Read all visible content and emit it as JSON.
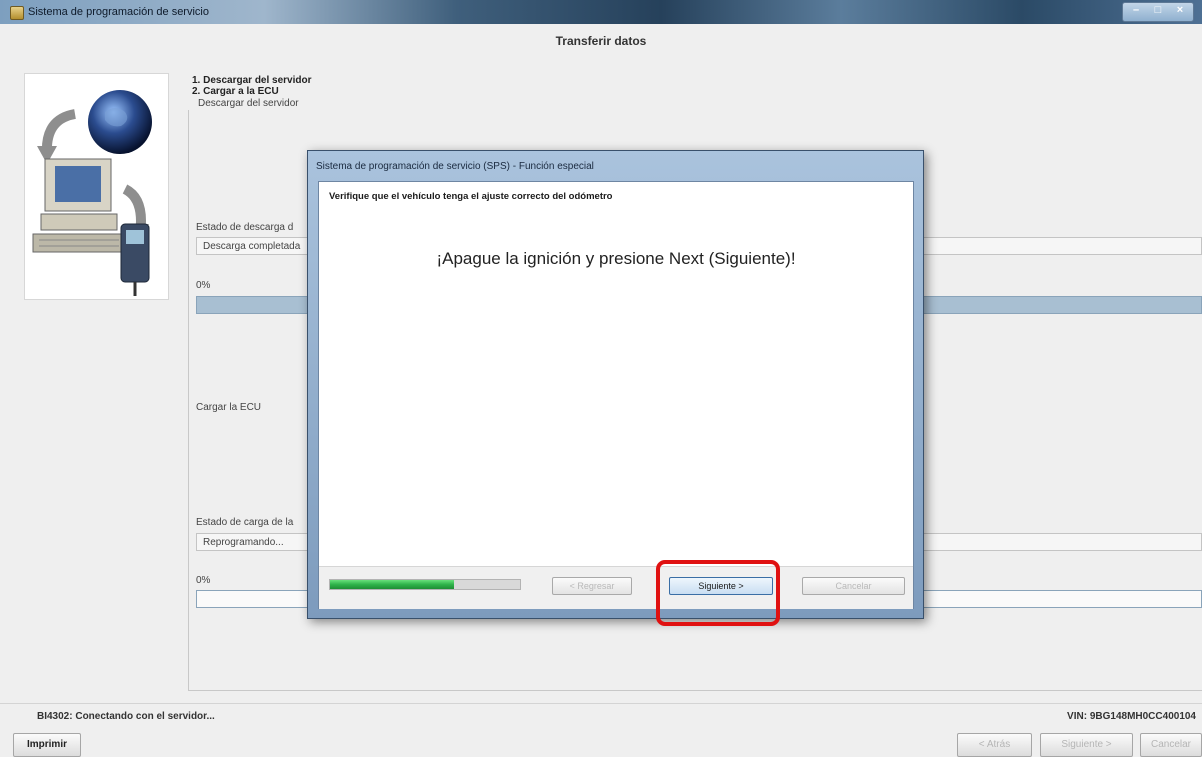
{
  "window": {
    "title": "Sistema de programación de servicio"
  },
  "header": {
    "title": "Transferir datos"
  },
  "steps": [
    "1. Descargar del servidor",
    "2. Cargar a la ECU"
  ],
  "download": {
    "section_label": "Descargar del servidor",
    "status_label": "Estado de descarga d",
    "status_value": "Descarga completada",
    "percent": "0%",
    "progress_fraction": 1.0
  },
  "upload": {
    "section_label": "Cargar la ECU",
    "status_label": "Estado de carga de la",
    "status_value": "Reprogramando...",
    "percent": "0%",
    "progress_fraction": 0.0
  },
  "status_bar": {
    "message": "BI4302: Conectando con el servidor...",
    "vin": "VIN: 9BG148MH0CC400104"
  },
  "bottom_buttons": {
    "print": "Imprimir",
    "back": "< Atrás",
    "next": "Siguiente >",
    "cancel": "Cancelar"
  },
  "dialog": {
    "title": "Sistema de programación de servicio (SPS) - Función especial",
    "instruction": "Verifique que el vehículo tenga el ajuste correcto del odómetro",
    "message": "¡Apague la ignición y presione Next (Siguiente)!",
    "progress_fraction": 0.65,
    "buttons": {
      "back": "< Regresar",
      "next": "Siguiente >",
      "cancel": "Cancelar"
    }
  },
  "colors": {
    "highlight": "#e01111",
    "progress_green": "#2fb34a",
    "bar_blue": "#a8bfd2"
  },
  "icons": [
    "app-icon",
    "globe-icon",
    "computer-icon",
    "scan-tool-icon",
    "circular-arrow-icon",
    "minimize-icon",
    "maximize-icon",
    "close-icon"
  ]
}
